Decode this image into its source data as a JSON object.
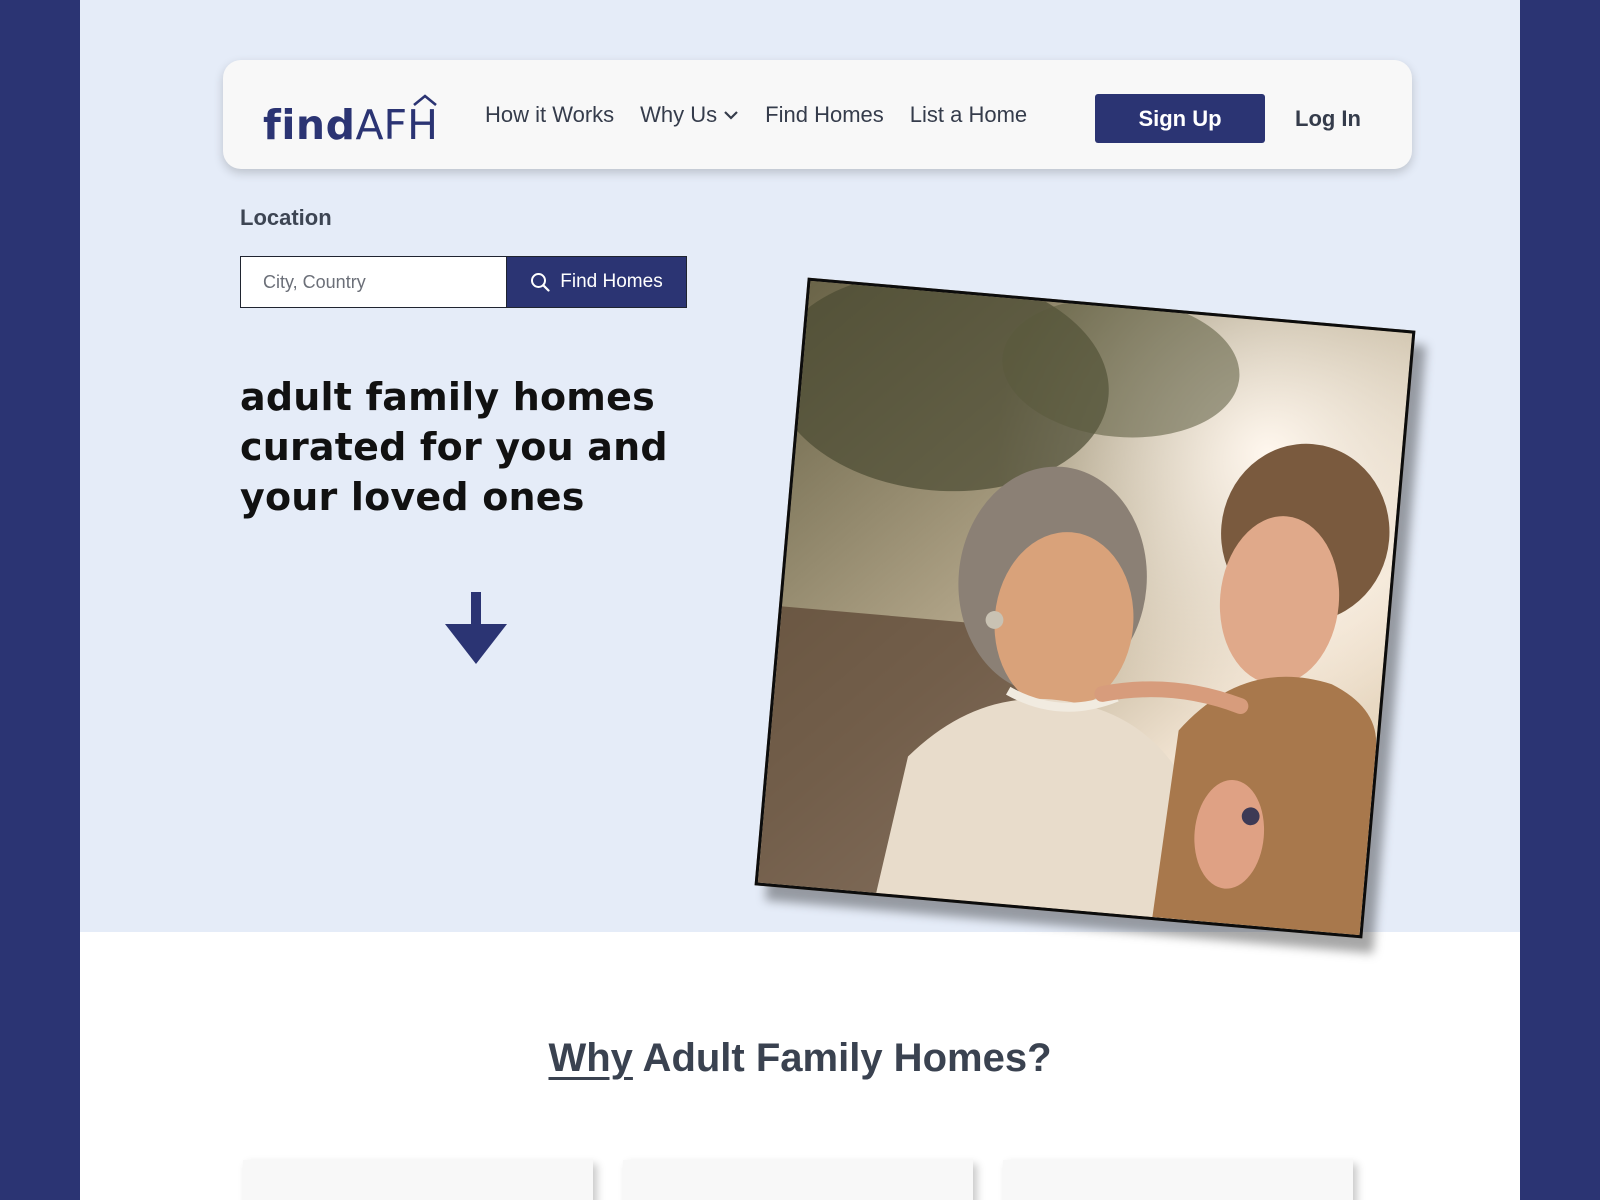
{
  "brand": {
    "logo_find": "find",
    "logo_afh": "AFH",
    "primary_color": "#2b3473",
    "hero_bg": "#e5ecf8"
  },
  "nav": {
    "links": [
      {
        "label": "How it Works",
        "icon": null
      },
      {
        "label": "Why Us",
        "icon": "chevron-down-icon"
      },
      {
        "label": "Find Homes",
        "icon": null
      },
      {
        "label": "List a Home",
        "icon": null
      }
    ],
    "signup_label": "Sign Up",
    "login_label": "Log In"
  },
  "search": {
    "label": "Location",
    "placeholder": "City, Country",
    "value": "",
    "button_label": "Find Homes",
    "button_icon": "search-icon"
  },
  "hero": {
    "headline": "adult family homes curated for you and your loved ones",
    "scroll_icon": "arrow-down-icon",
    "photo_subject": "hero-photo"
  },
  "why": {
    "title_emphasis": "Why",
    "title_rest": " Adult Family Homes?",
    "cards": [
      {},
      {},
      {}
    ]
  }
}
